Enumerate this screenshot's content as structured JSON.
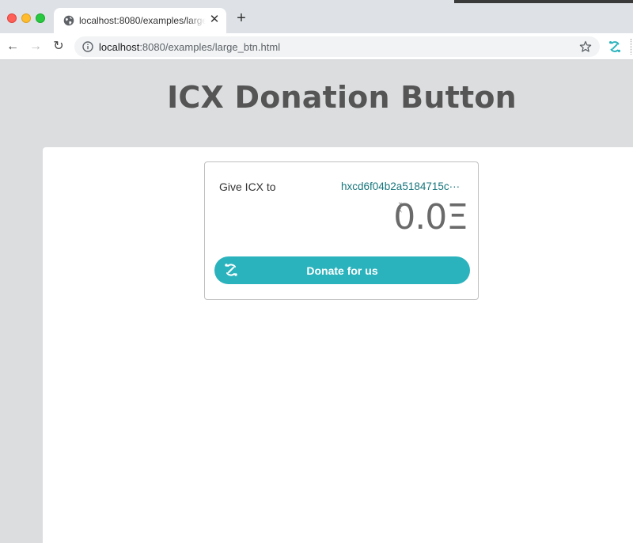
{
  "browser": {
    "tab": {
      "title": "localhost:8080/examples/large_btn.html",
      "close_glyph": "✕"
    },
    "new_tab_glyph": "+",
    "nav": {
      "back_glyph": "←",
      "forward_glyph": "→",
      "reload_glyph": "↻"
    },
    "address_bar": {
      "host": "localhost",
      "path": ":8080/examples/large_btn.html"
    }
  },
  "page": {
    "title": "ICX Donation Button"
  },
  "donation_card": {
    "give_label": "Give ICX to",
    "address": "hxcd6f04b2a5184715c···",
    "amount": "0.0Ξ",
    "button_label": "Donate for us"
  },
  "colors": {
    "accent": "#2bb3bd",
    "address_text": "#16767c",
    "page_background": "#dcdddf"
  },
  "icons": [
    "globe-icon",
    "close-icon",
    "plus-icon",
    "back-arrow-icon",
    "forward-arrow-icon",
    "reload-icon",
    "info-icon",
    "star-icon",
    "icon-extension-icon",
    "icon-logo-icon"
  ]
}
